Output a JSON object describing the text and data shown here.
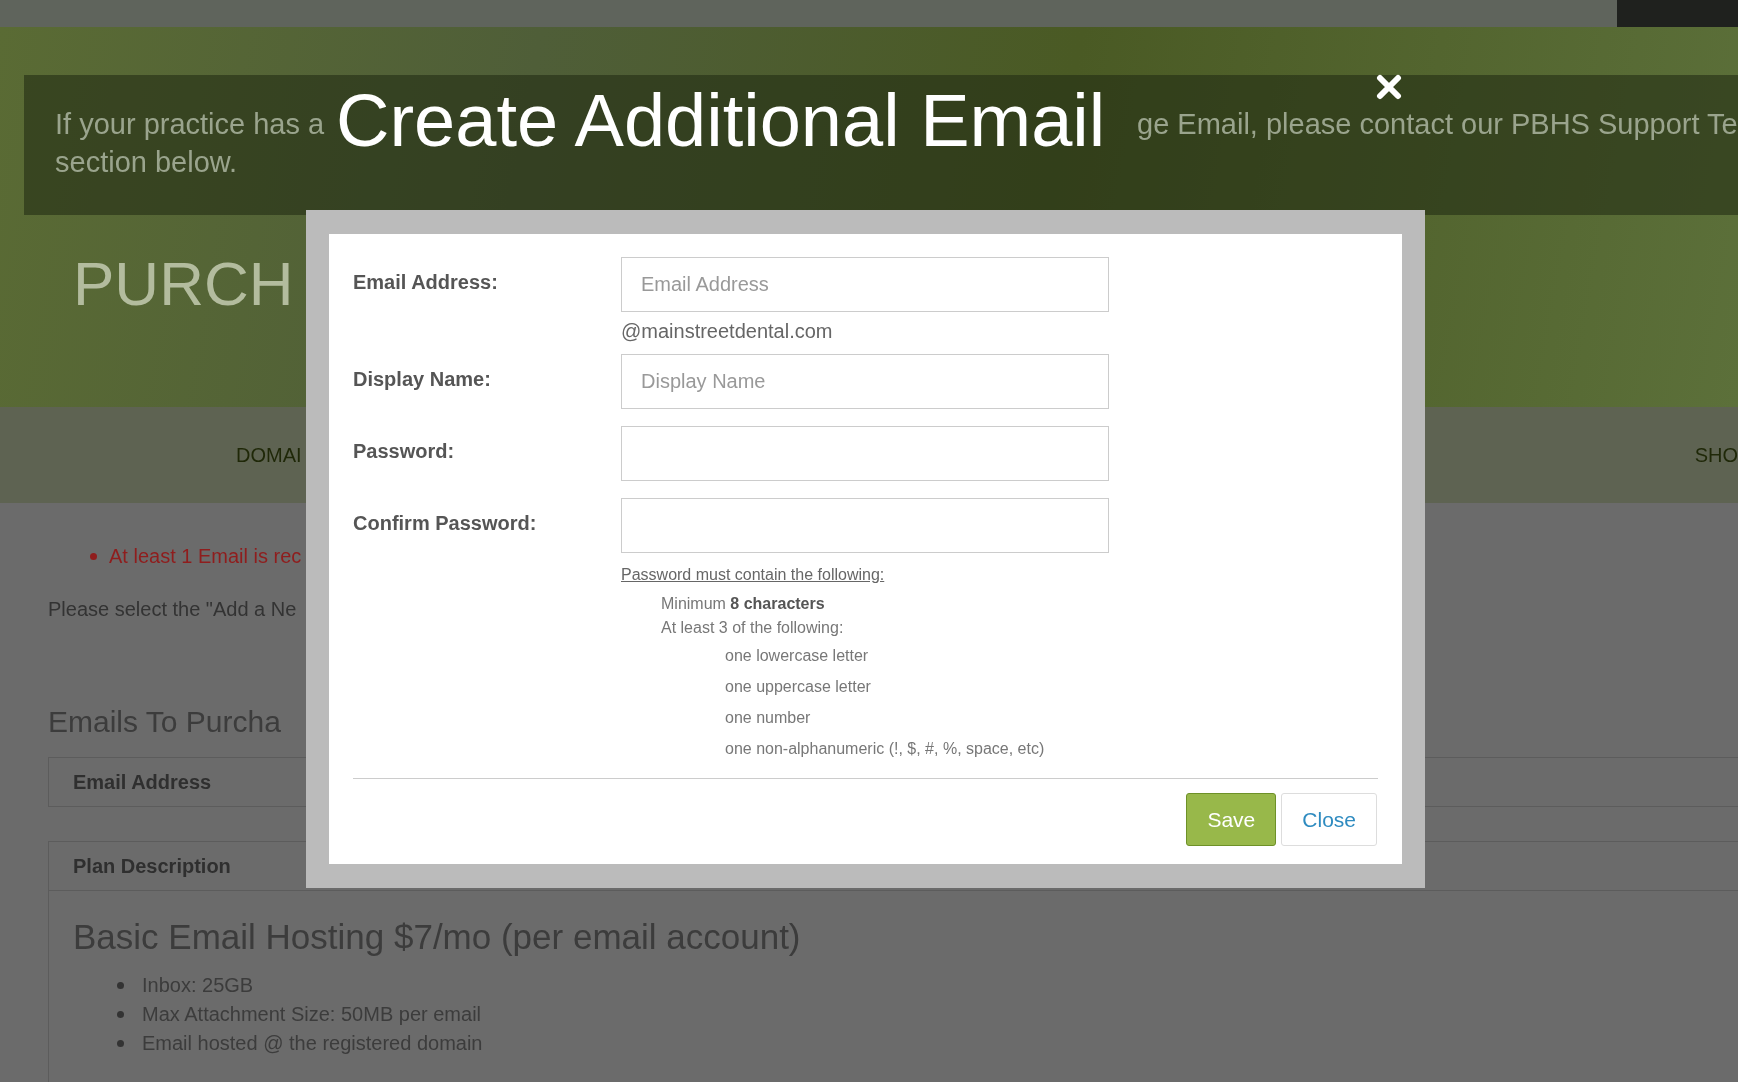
{
  "page": {
    "notice": {
      "first_line": [
        "If your practice has a",
        "ge Email, please contact our PBHS Support Te"
      ],
      "second_line": "section below."
    },
    "heading": "PURCH",
    "nav": [
      {
        "label": "DOMAI"
      },
      {
        "label": "SHO"
      }
    ],
    "error": "At least 1 Email is rec",
    "instruction": "Please select the \"Add a Ne",
    "section_title": "Emails To Purcha",
    "email_table": {
      "columns": [
        "Email Address"
      ]
    },
    "plan": {
      "header": "Plan Description",
      "title": "Basic Email Hosting $7/mo (per email account)",
      "features": [
        "Inbox: 25GB",
        "Max Attachment Size: 50MB per email",
        "Email hosted @ the registered domain"
      ]
    }
  },
  "modal": {
    "title": "Create Additional Email",
    "fields": [
      {
        "label": "Email Address:",
        "placeholder": "Email Address",
        "suffix": "@mainstreetdental.com"
      },
      {
        "label": "Display Name:",
        "placeholder": "Display Name"
      },
      {
        "label": "Password:"
      },
      {
        "label": "Confirm Password:"
      }
    ],
    "rules": {
      "heading": "Password must contain the following:",
      "minimum": "Minimum **8 characters**",
      "intro": "At least 3 of the following:",
      "items": [
        "one lowercase letter",
        "one uppercase letter",
        "one number",
        "one non-alphanumeric (!, $, #, %, space, etc)"
      ]
    },
    "buttons": [
      {
        "label": "Save",
        "kind": "primary"
      },
      {
        "label": "Close",
        "kind": "secondary"
      }
    ]
  }
}
